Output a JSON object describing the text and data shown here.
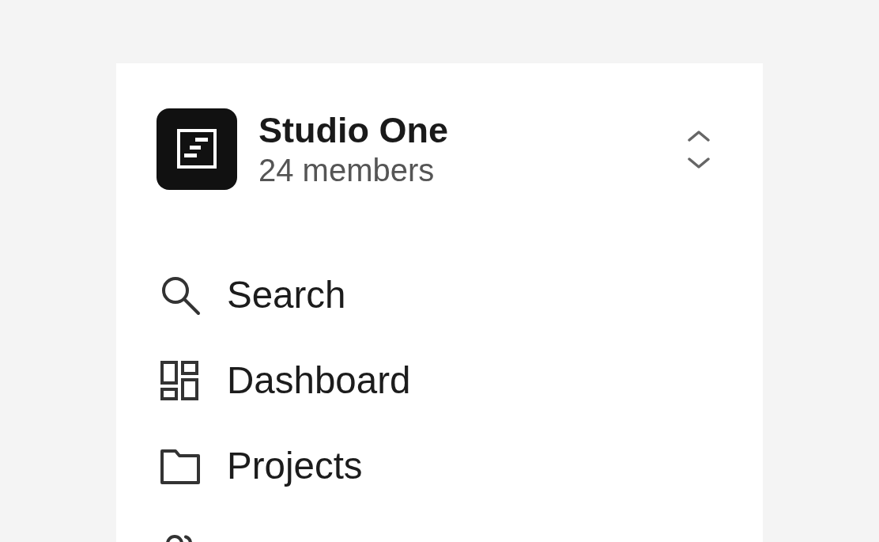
{
  "workspace": {
    "name": "Studio One",
    "members": "24 members"
  },
  "nav": {
    "items": [
      {
        "kind": "search",
        "label": "Search"
      },
      {
        "kind": "dashboard",
        "label": "Dashboard"
      },
      {
        "kind": "folder",
        "label": "Projects"
      },
      {
        "kind": "people"
      }
    ]
  }
}
